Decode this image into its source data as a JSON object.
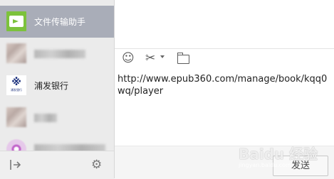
{
  "sidebar": {
    "items": [
      {
        "label": "文件传输助手",
        "active": true,
        "avatar": "folder-transfer-icon"
      },
      {
        "label": "",
        "avatar": "blurred-avatar"
      },
      {
        "label": "浦发银行",
        "avatar": "bank-logo"
      },
      {
        "label": "",
        "avatar": "blurred-avatar"
      },
      {
        "label": "",
        "avatar": "purple-avatar"
      }
    ],
    "bank_logo_mark": "※",
    "bank_logo_text": "浦发银行"
  },
  "footer_icons": {
    "left": "logout-icon",
    "right": "gear-icon"
  },
  "toolbar": {
    "icons": [
      "emoji-icon",
      "scissors-icon",
      "folder-icon"
    ]
  },
  "message": {
    "text": "http://www.epub360.com/manage/book/kqq0wq/player"
  },
  "send_button": {
    "label": "发送"
  },
  "watermark": {
    "text": "Baidu 经验",
    "sub": "jingyan.baidu.com"
  },
  "colors": {
    "active_item": "#a9adb8",
    "folder_green": "#7cc23c",
    "sidebar_bg": "#ebebeb"
  }
}
